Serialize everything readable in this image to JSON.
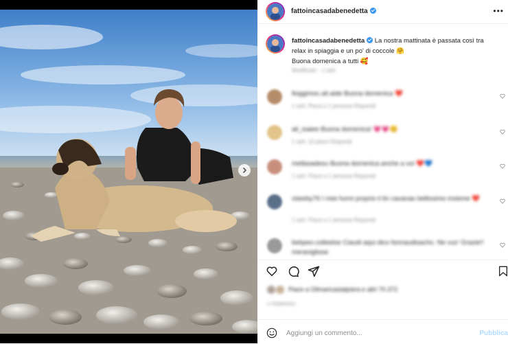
{
  "post": {
    "username": "fattoincasadabenedetta",
    "caption_line1": "La nostra mattinata è passata così tra",
    "caption_line2": "relax in spiaggia e un po' di coccole 🤗",
    "caption_line3": "Buona domenica a tutti 🥰",
    "caption_meta": "Modificato · 1 sett."
  },
  "comments": [
    {
      "text": "fioggimoc.ali.aide Buona domenica ❤️",
      "meta": "1 sett.   Piace a 1 persona   Rispondi",
      "color": "#b58c6a"
    },
    {
      "text": "ali_isaiee Buona domenica! 💗💗😊",
      "meta": "1 sett.   10 piace   Rispondi",
      "color": "#e2c48a"
    },
    {
      "text": "mellasadesu Buona domenica anche a voi ❤️💙",
      "meta": "1 sett.   Piace a 1 persona   Rispondi",
      "color": "#c98f7d"
    },
    {
      "text": "cbeeby76 I miei furmi proprio il tin cavanas bellissimo insieme ❤️",
      "meta": "1 sett.   Piace a 1 persona   Rispondi",
      "color": "#5a6f88"
    },
    {
      "text": "bebpeo.colleetse Ciaudi aqui dico fonnaudisacho. Ne vuo' Grazie!! meravigliose",
      "meta": "",
      "color": "#9a9a9a"
    }
  ],
  "likes_text": "Piace a Oilmaricastalpiera e altri 70.372",
  "date_text": "4 FEBBRAIO",
  "add_comment": {
    "placeholder": "Aggiungi un commento...",
    "publish_label": "Pubblica"
  },
  "colors": {
    "accent": "#0095f6",
    "verified": "#3897f0",
    "publish_disabled": "#b3dbff"
  }
}
